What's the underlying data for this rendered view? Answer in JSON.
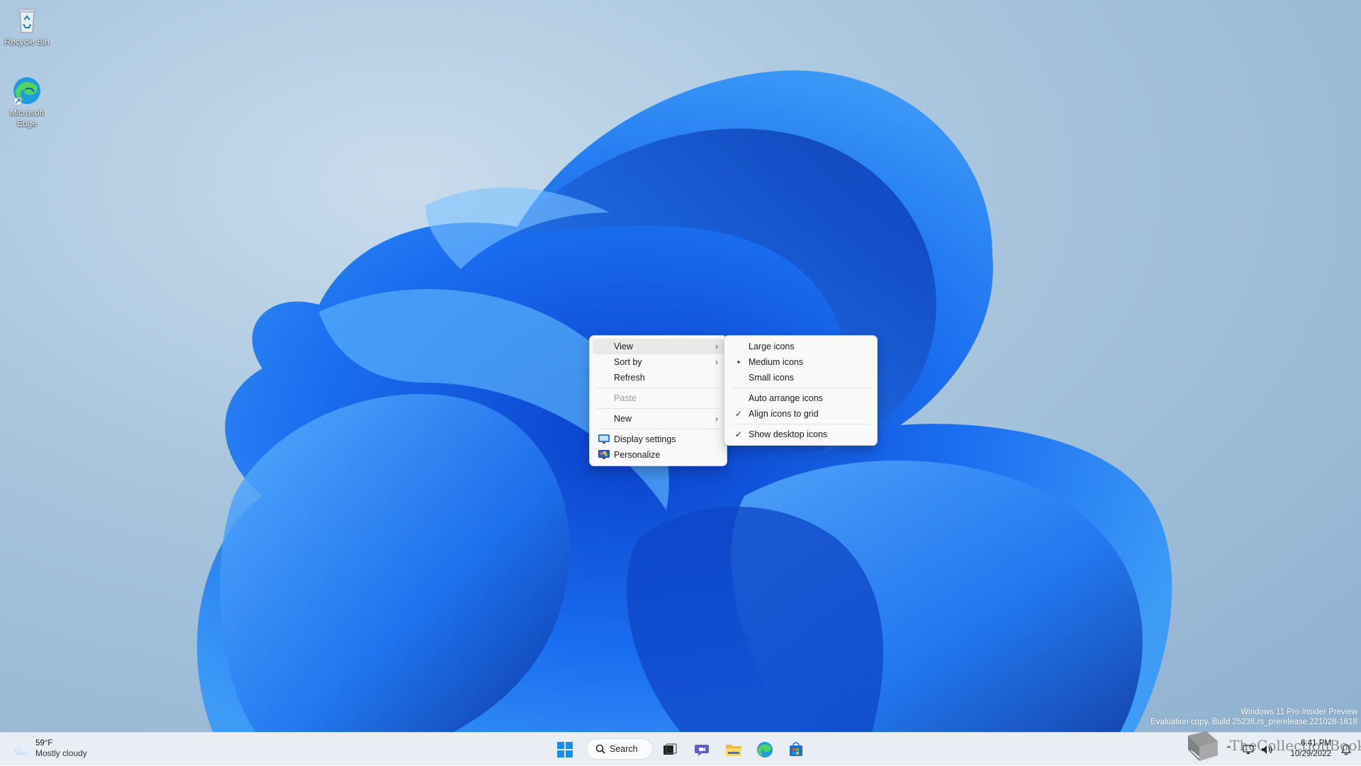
{
  "desktop": {
    "icons": [
      {
        "label": "Recycle Bin",
        "icon": "recycle-bin-icon"
      },
      {
        "label": "Microsoft Edge",
        "icon": "edge-icon"
      }
    ],
    "watermark": {
      "line1": "Windows 11 Pro Insider Preview",
      "line2": "Evaluation copy. Build 25236.rs_prerelease.221028-1618"
    }
  },
  "context_menu": {
    "items": [
      {
        "label": "View",
        "has_submenu": true,
        "highlighted": true
      },
      {
        "label": "Sort by",
        "has_submenu": true
      },
      {
        "label": "Refresh"
      },
      {
        "label": "Paste",
        "disabled": true
      },
      {
        "label": "New",
        "has_submenu": true
      },
      {
        "label": "Display settings",
        "icon": "display-settings-icon"
      },
      {
        "label": "Personalize",
        "icon": "personalize-icon"
      }
    ]
  },
  "view_submenu": {
    "items": [
      {
        "label": "Large icons",
        "mark": ""
      },
      {
        "label": "Medium icons",
        "mark": "•"
      },
      {
        "label": "Small icons",
        "mark": ""
      },
      {
        "label": "Auto arrange icons",
        "mark": ""
      },
      {
        "label": "Align icons to grid",
        "mark": "✓"
      },
      {
        "label": "Show desktop icons",
        "mark": "✓"
      }
    ]
  },
  "taskbar": {
    "weather": {
      "temp": "59°F",
      "condition": "Mostly cloudy",
      "icon": "cloud-icon"
    },
    "search_label": "Search",
    "pinned": [
      "start-icon",
      "task-view-icon",
      "teams-chat-icon",
      "file-explorer-icon",
      "edge-icon",
      "store-icon"
    ],
    "clock": {
      "time": "6:41 PM",
      "date": "10/29/2022"
    },
    "overlay_text": "TheCollectionBook"
  },
  "colors": {
    "accent": "#0067c0",
    "menu_bg": "#f9f9f9",
    "highlight": "#e9e9e9"
  }
}
